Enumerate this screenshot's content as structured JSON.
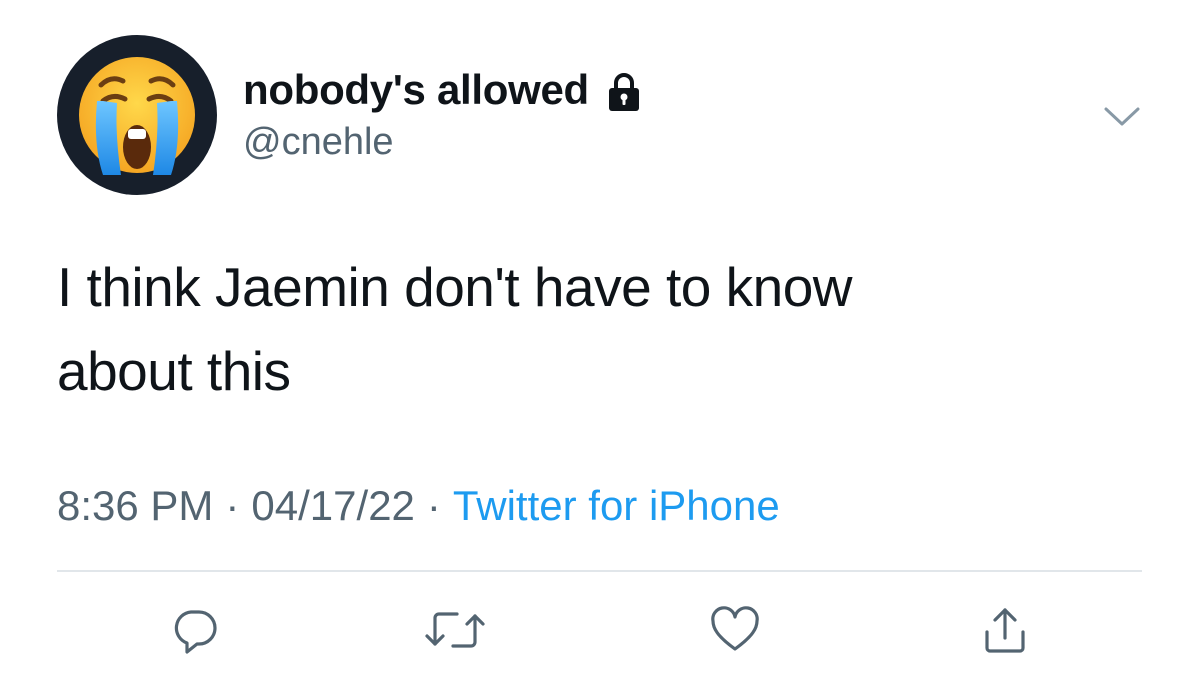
{
  "author": {
    "display_name": "nobody's allowed",
    "handle": "@cnehle",
    "protected_icon": "lock-icon",
    "avatar_emoji": "loudly-crying-face"
  },
  "tweet": {
    "text_line_1": "I think Jaemin don't have to know",
    "text_line_2": "about this"
  },
  "meta": {
    "time": "8:36 PM",
    "separator": "·",
    "date": "04/17/22",
    "source": "Twitter for iPhone"
  },
  "actions": [
    {
      "icon": "reply-icon"
    },
    {
      "icon": "retweet-icon"
    },
    {
      "icon": "like-icon"
    },
    {
      "icon": "share-icon"
    }
  ],
  "colors": {
    "text": "#0f1419",
    "secondary": "#536471",
    "link": "#1d9bf0",
    "divider": "#e1e6ea"
  }
}
